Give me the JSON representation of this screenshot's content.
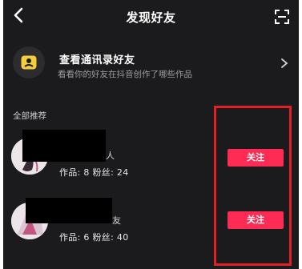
{
  "header": {
    "title": "发现好友"
  },
  "contacts_card": {
    "title": "查看通讯录好友",
    "subtitle": "看看你的好友在抖音创作了哪些作品"
  },
  "section": {
    "label": "全部推荐"
  },
  "users": [
    {
      "name_suffix": "人",
      "stats": "作品: 8  粉丝: 24",
      "follow_label": "关注"
    },
    {
      "name_suffix": "友",
      "stats": "作品: 6  粉丝: 40",
      "follow_label": "关注"
    }
  ],
  "colors": {
    "background": "#1b1b1d",
    "follow_button": "#fe2c55",
    "highlight_box": "#e21e26",
    "contacts_icon": "#f3cd3a"
  },
  "icons": {
    "back": "chevron-left-icon",
    "scan": "scan-icon",
    "contacts": "contacts-book-icon",
    "chevron": "chevron-right-icon"
  }
}
